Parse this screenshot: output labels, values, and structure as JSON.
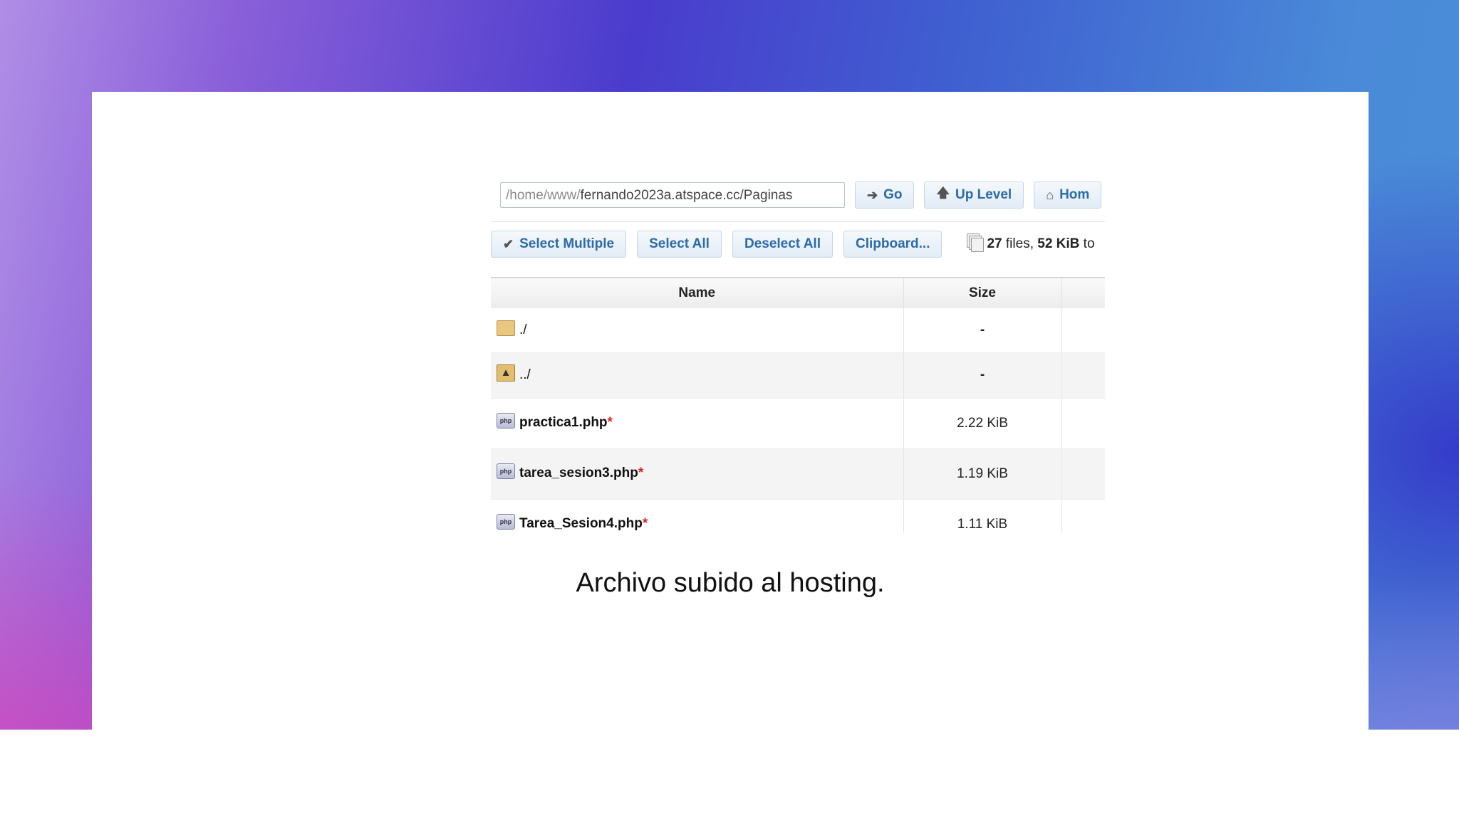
{
  "pathbar": {
    "path_prefix": "/home/www/",
    "path_main": "fernando2023a.atspace.cc/Paginas",
    "go_label": "Go",
    "up_level_label": "Up Level",
    "home_label": "Hom"
  },
  "toolbar": {
    "select_multiple_label": "Select Multiple",
    "select_all_label": "Select All",
    "deselect_all_label": "Deselect All",
    "clipboard_label": "Clipboard...",
    "summary_count": "27",
    "summary_files_word": " files, ",
    "summary_size": "52 KiB",
    "summary_tail": " to"
  },
  "table": {
    "headers": {
      "name": "Name",
      "size": "Size"
    },
    "rows": [
      {
        "name": "./",
        "size": "-",
        "type": "folder"
      },
      {
        "name": "../",
        "size": "-",
        "type": "parent"
      },
      {
        "name": "practica1.php",
        "marker": "*",
        "size": "2.22 KiB",
        "type": "php"
      },
      {
        "name": "tarea_sesion3.php",
        "marker": "*",
        "size": "1.19 KiB",
        "type": "php"
      },
      {
        "name": "Tarea_Sesion4.php",
        "marker": "*",
        "size": "1.11 KiB",
        "type": "php"
      }
    ]
  },
  "icons": {
    "go": "arrow-right-icon",
    "up_level": "arrow-up-icon",
    "home": "home-icon",
    "select_multiple": "checkmark-icon",
    "summary": "files-stack-icon",
    "folder": "folder-icon",
    "parent": "folder-up-icon",
    "php": "php-file-icon"
  },
  "caption": "Archivo subido al hosting."
}
